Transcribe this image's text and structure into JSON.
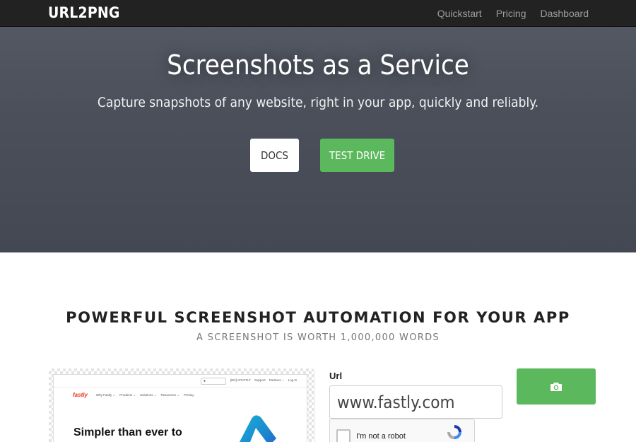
{
  "nav": {
    "brand": "URL2PNG",
    "links": [
      "Quickstart",
      "Pricing",
      "Dashboard"
    ]
  },
  "hero": {
    "title": "Screenshots as a Service",
    "subtitle": "Capture snapshots of any website, right in your app, quickly and reliably.",
    "docs_button": "DOCS",
    "test_button": "TEST DRIVE"
  },
  "features": {
    "title": "POWERFUL SCREENSHOT AUTOMATION FOR YOUR APP",
    "subtitle": "A SCREENSHOT IS WORTH 1,000,000 WORDS"
  },
  "preview": {
    "logo": "fastly",
    "nav_items": [
      "Why Fastly ⌄",
      "Products ⌄",
      "Solutions ⌄",
      "Resources ⌄",
      "Pricing"
    ],
    "top_links": [
      "[EN] ATKSTLT",
      "Support",
      "Partners ⌄",
      "Log In"
    ],
    "search_icon_char": "●",
    "headline": "Simpler than ever to"
  },
  "form": {
    "url_label": "Url",
    "url_value": "www.fastly.com",
    "capture_icon": "camera-icon",
    "recaptcha_label": "I'm not a robot"
  },
  "colors": {
    "navbar": "#222222",
    "hero": "#4b505b",
    "accent_green": "#5cb85c"
  }
}
